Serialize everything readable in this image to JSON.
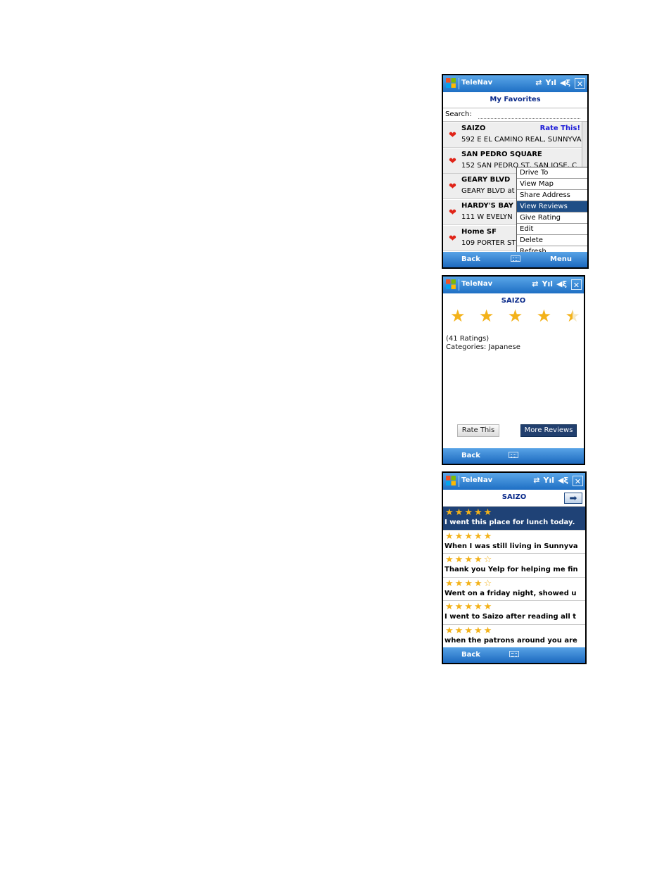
{
  "app": {
    "title": "TeleNav"
  },
  "screen1": {
    "heading": "My Favorites",
    "search_label": "Search:",
    "search_value": "",
    "rate_link": "Rate This!",
    "favorites": [
      {
        "name": "SAIZO",
        "address": "592 E EL CAMINO REAL, SUNNYVA"
      },
      {
        "name": "SAN PEDRO SQUARE",
        "address": "152 SAN PEDRO ST, SAN JOSE, C"
      },
      {
        "name": "GEARY BLVD",
        "address": "GEARY BLVD at"
      },
      {
        "name": "HARDY'S BAY",
        "address": "111 W EVELYN"
      },
      {
        "name": "Home SF",
        "address": "109 PORTER ST"
      }
    ],
    "context_menu": [
      "Drive To",
      "View Map",
      "Share Address",
      "View Reviews",
      "Give Rating",
      "Edit",
      "Delete",
      "Refresh"
    ],
    "selected_menu_item": "View Reviews",
    "back_label": "Back",
    "menu_label": "Menu"
  },
  "screen2": {
    "heading": "SAIZO",
    "rating": 4.5,
    "ratings_count_text": "(41 Ratings)",
    "categories_text": "Categories: Japanese",
    "rate_button": "Rate This",
    "more_button": "More Reviews",
    "back_label": "Back"
  },
  "screen3": {
    "heading": "SAIZO",
    "reviews": [
      {
        "rating": 5,
        "text": "I went this place for lunch today."
      },
      {
        "rating": 5,
        "text": "When I was still living in Sunnyva"
      },
      {
        "rating": 4,
        "text": "Thank you Yelp for helping me fin"
      },
      {
        "rating": 4,
        "text": "Went on a friday night, showed u"
      },
      {
        "rating": 5,
        "text": "I went to Saizo after reading all t"
      },
      {
        "rating": 5,
        "text": "when the patrons around you are"
      }
    ],
    "back_label": "Back"
  },
  "icons": {
    "start": "windows-flag-icon",
    "sync": "sync-arrows-icon",
    "signal": "signal-bars-icon",
    "volume": "speaker-icon",
    "close": "close-icon",
    "favorite": "heart-icon",
    "keyboard": "keyboard-icon",
    "next": "arrow-right-icon"
  },
  "colors": {
    "titlebar": "#1e6fc4",
    "heading": "#0a2a8a",
    "selected": "#1f4e86",
    "star": "#f3b21a",
    "heart": "#e02418",
    "rate_link": "#1a1ad8"
  }
}
